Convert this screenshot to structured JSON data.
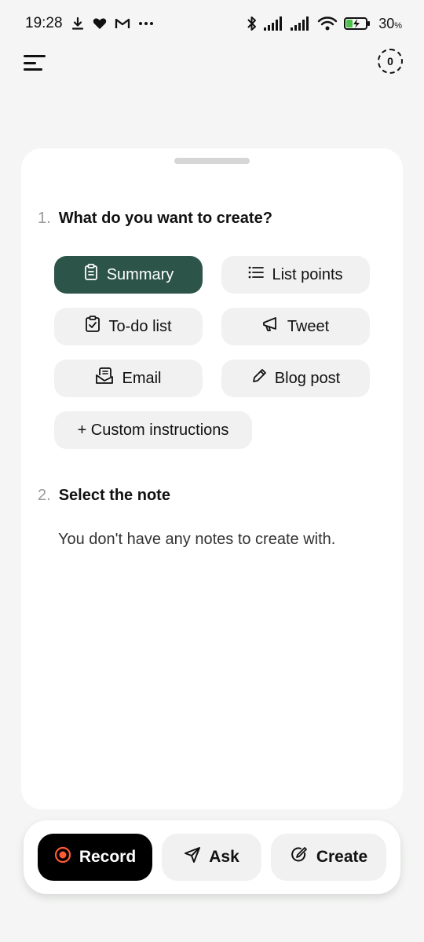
{
  "status_bar": {
    "time": "19:28",
    "battery_percent": "30",
    "battery_unit": "%",
    "left_icons": [
      "download-icon",
      "heart-icon",
      "gmail-icon",
      "more-dots-icon"
    ],
    "right_icons": [
      "bluetooth-icon",
      "signal-icon",
      "signal-icon",
      "wifi-icon",
      "battery-charging-icon"
    ]
  },
  "app_bar": {
    "counter": "0"
  },
  "section1": {
    "number": "1.",
    "title": "What do you want to create?"
  },
  "options": {
    "summary": "Summary",
    "list_points": "List points",
    "todo": "To-do list",
    "tweet": "Tweet",
    "email": "Email",
    "blog": "Blog post",
    "custom": "+ Custom instructions",
    "selected": "Summary"
  },
  "section2": {
    "number": "2.",
    "title": "Select the note",
    "empty_message": "You don't have any notes to create with."
  },
  "bottom_bar": {
    "record": "Record",
    "ask": "Ask",
    "create": "Create"
  },
  "colors": {
    "accent": "#2c5449",
    "record_dot": "#ff5a36",
    "background": "#f4f5f4"
  }
}
